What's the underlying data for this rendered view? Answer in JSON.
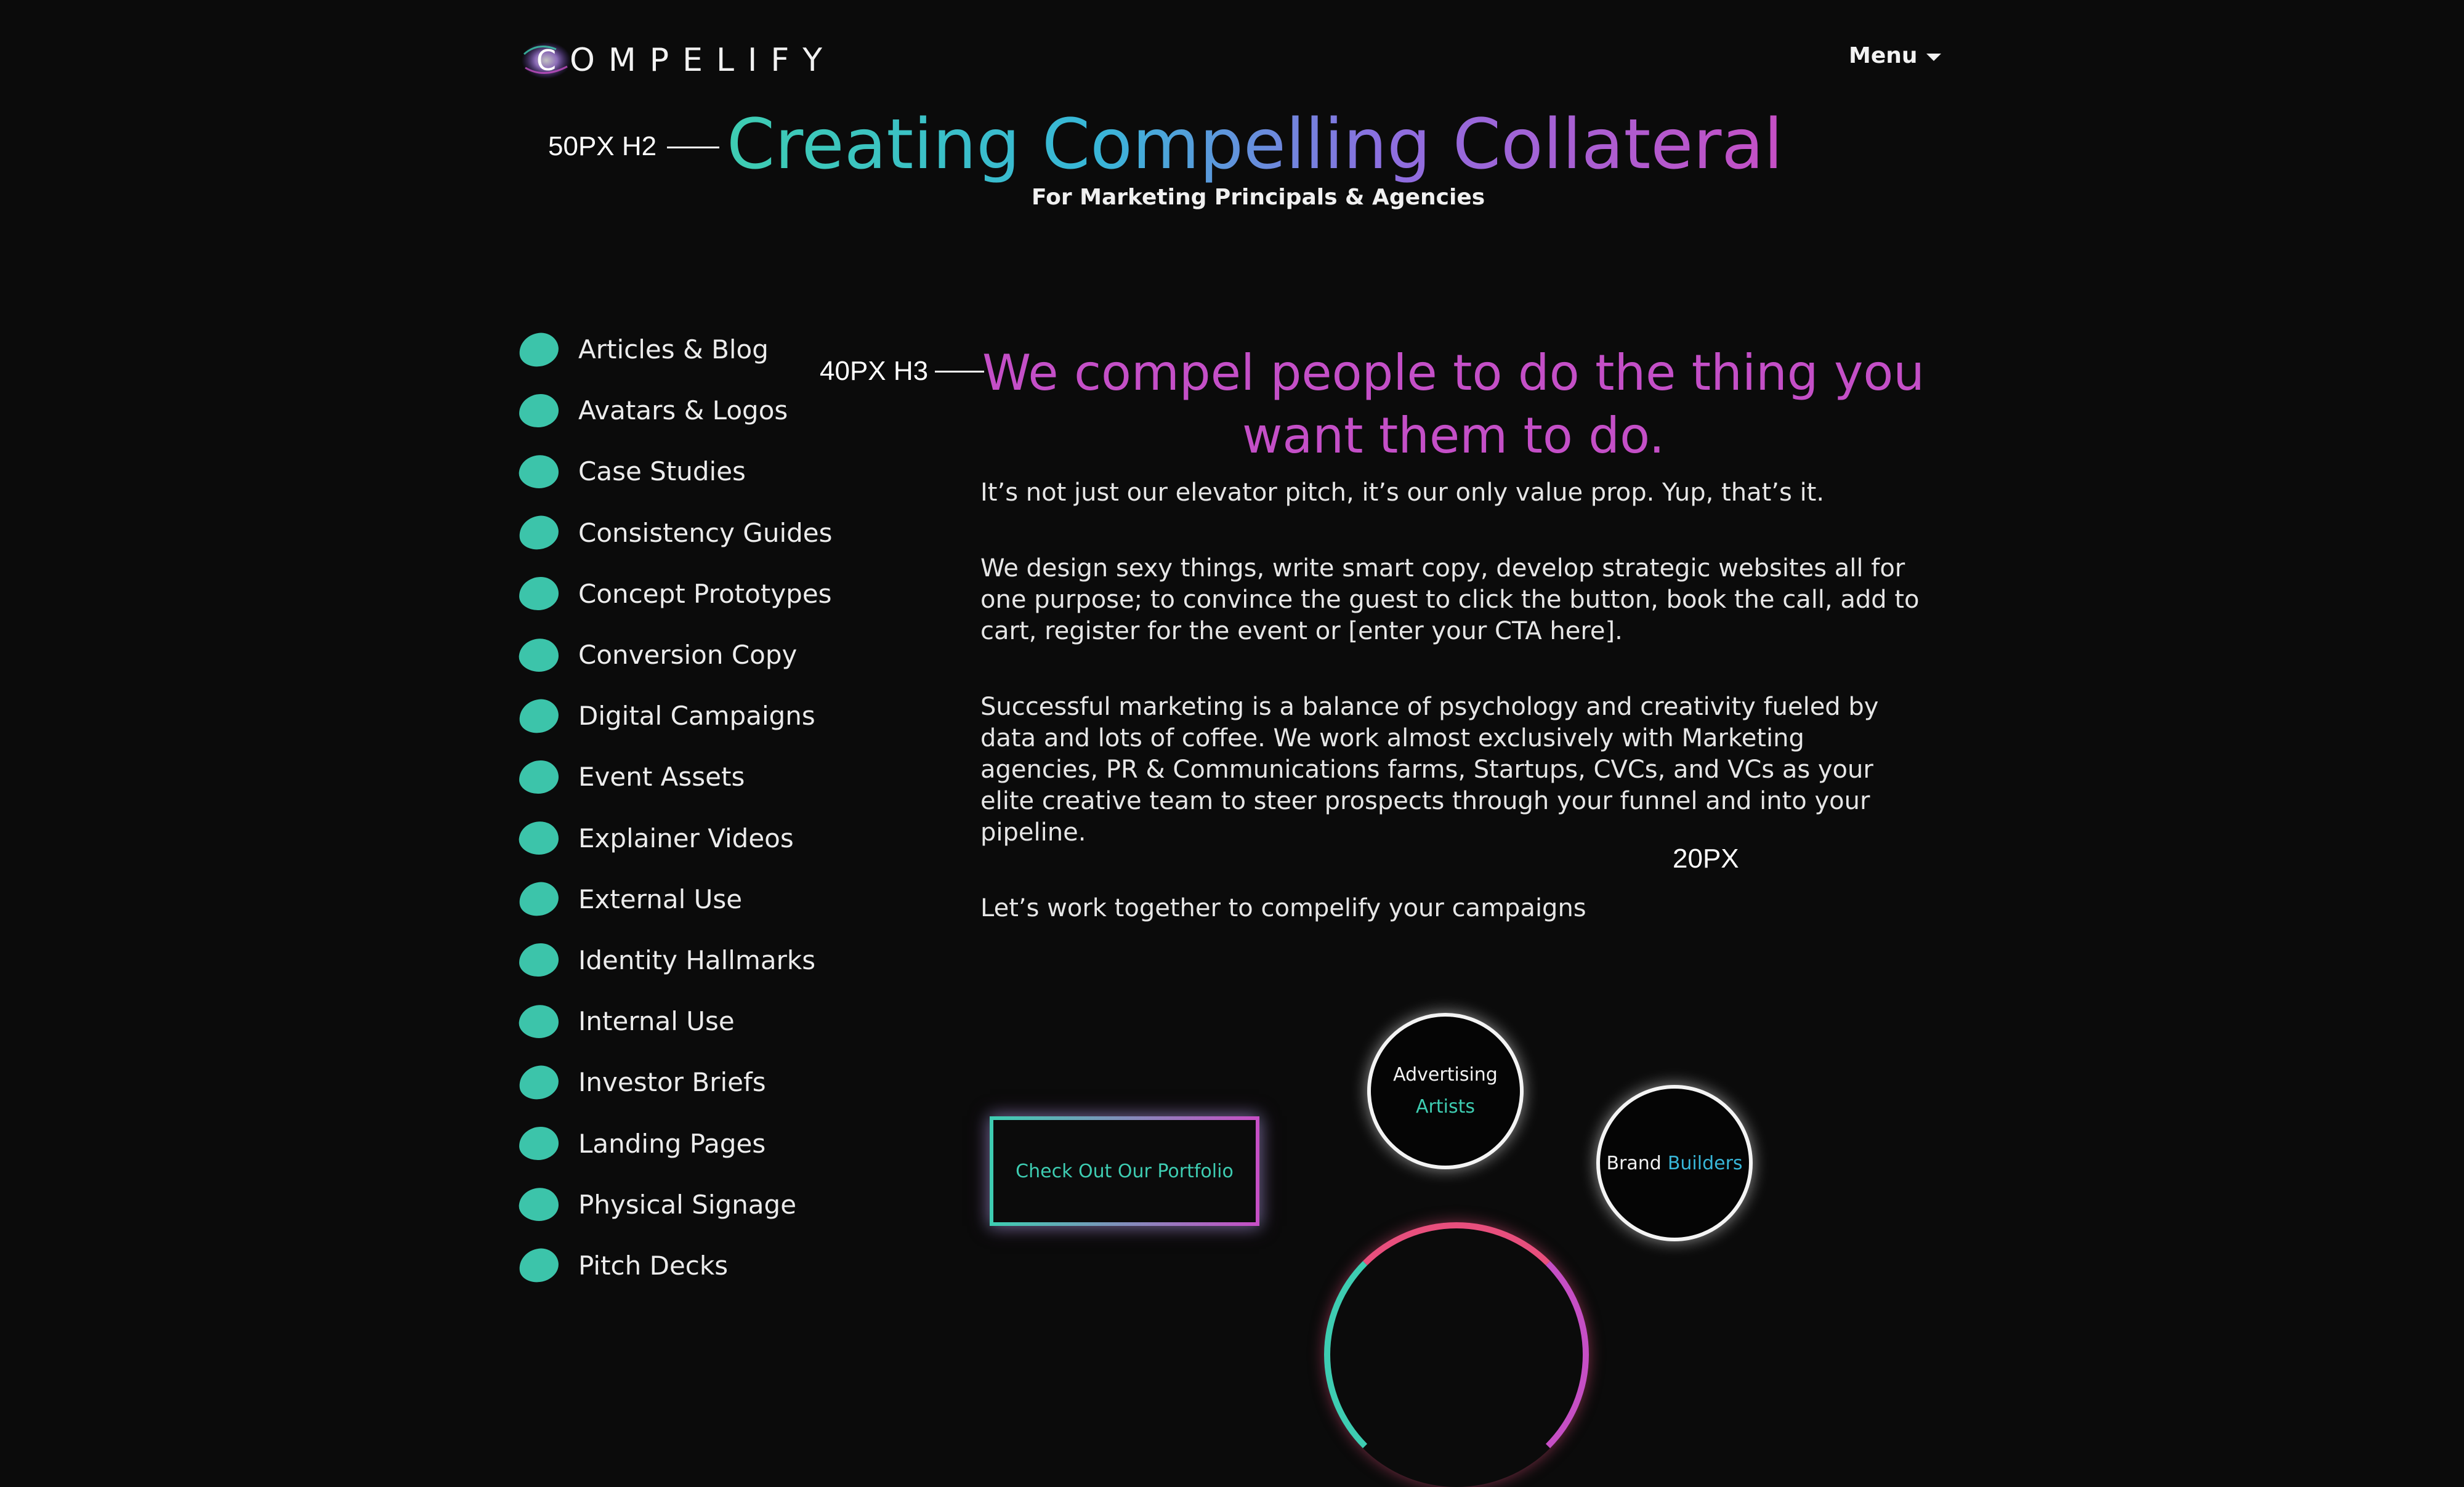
{
  "header": {
    "brand_text": "OMPELIFY",
    "logo_letter": "C",
    "menu_label": "Menu"
  },
  "hero": {
    "title": "Creating Compelling Collateral",
    "subtitle": "For Marketing Principals & Agencies"
  },
  "annotations": {
    "h2": "50PX H2",
    "h3": "40PX H3",
    "body": "20PX"
  },
  "services": [
    "Articles & Blog",
    "Avatars & Logos",
    "Case Studies",
    "Consistency Guides",
    "Concept Prototypes",
    "Conversion Copy",
    "Digital Campaigns",
    "Event Assets",
    "Explainer Videos",
    "External Use",
    "Identity Hallmarks",
    "Internal Use",
    "Investor Briefs",
    "Landing Pages",
    "Physical Signage",
    "Pitch Decks"
  ],
  "main": {
    "heading": "We compel people to do the thing you want them to do.",
    "paragraphs": [
      "It’s not just our elevator pitch, it’s our only value prop. Yup, that’s it.",
      "We design sexy things, write smart copy, develop strategic websites all for one purpose; to convince the guest to click the button, book the call, add to cart, register for the event or [enter your CTA here].",
      "Successful marketing is a balance of psychology and creativity fueled by data and lots of coffee. We work almost exclusively with Marketing agencies, PR & Communications farms, Startups, CVCs, and VCs as your elite creative team to steer prospects through your funnel and into your pipeline.",
      "Let’s work together to compelify your campaigns"
    ]
  },
  "cta": {
    "label": "Check Out Our Portfolio"
  },
  "circles": {
    "advertising": {
      "line1": "Advertising",
      "line2": "Artists"
    },
    "brand": {
      "word1": "Brand",
      "word2": "Builders"
    }
  },
  "colors": {
    "background": "#0b0b0b",
    "teal": "#3ecdb2",
    "magenta": "#c44fc7",
    "blue": "#38b6d8"
  }
}
